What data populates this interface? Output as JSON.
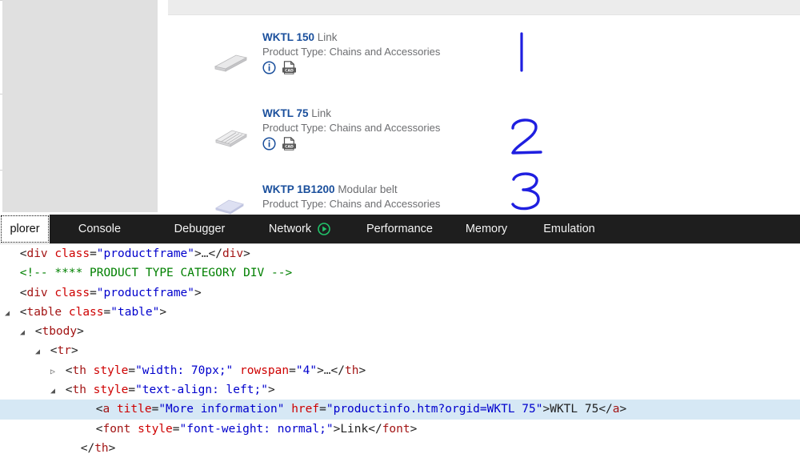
{
  "browser": {
    "products": [
      {
        "code": "WKTL 150",
        "name": "Link",
        "type_label": "Product Type: Chains and Accessories",
        "info_icon": "info-circle-icon",
        "cad_icon": "cad-file-icon",
        "thumbnail": "flat-bar-link-thumbnail",
        "annotation": "1"
      },
      {
        "code": "WKTL 75",
        "name": "Link",
        "type_label": "Product Type: Chains and Accessories",
        "info_icon": "info-circle-icon",
        "cad_icon": "cad-file-icon",
        "thumbnail": "slatted-link-thumbnail",
        "annotation": "2"
      },
      {
        "code": "WKTP 1B1200",
        "name": "Modular belt",
        "type_label": "Product Type: Chains and Accessories",
        "info_icon": "info-circle-icon",
        "cad_icon": "cad-file-icon",
        "thumbnail": "modular-belt-plate-thumbnail",
        "annotation": "3"
      }
    ],
    "colors": {
      "product_code_blue": "#1a4f9c",
      "body_gray": "#6d6e71",
      "panel_gray": "#e0e0e0",
      "header_band": "#ececec",
      "annotation_blue": "#1f1fe0"
    }
  },
  "devtools": {
    "tabs": [
      {
        "label": "plorer",
        "full_label": "DOM Explorer",
        "active": true,
        "icon": null
      },
      {
        "label": "Console",
        "active": false,
        "icon": null
      },
      {
        "label": "Debugger",
        "active": false,
        "icon": null
      },
      {
        "label": "Network",
        "active": false,
        "icon": "play-circle-icon"
      },
      {
        "label": "Performance",
        "active": false,
        "icon": null
      },
      {
        "label": "Memory",
        "active": false,
        "icon": null
      },
      {
        "label": "Emulation",
        "active": false,
        "icon": null
      }
    ],
    "colors": {
      "tabbar_bg": "#1e1e1e",
      "tab_text": "#f2f2f2",
      "selected_row_bg": "#d6e8f5",
      "tag_color": "#a31515",
      "attr_color": "#ce0000",
      "value_color": "#0000cd",
      "comment_color": "#008000"
    },
    "code_lines": [
      {
        "indent": 0,
        "twisty": "none",
        "selected": false,
        "tokens": [
          {
            "t": "punct",
            "v": "<"
          },
          {
            "t": "tw",
            "v": "div"
          },
          {
            "t": "punct",
            "v": " "
          },
          {
            "t": "attr",
            "v": "class"
          },
          {
            "t": "punct",
            "v": "="
          },
          {
            "t": "val",
            "v": "\"productframe\""
          },
          {
            "t": "punct",
            "v": ">"
          },
          {
            "t": "ell",
            "v": "…"
          },
          {
            "t": "punct",
            "v": "</"
          },
          {
            "t": "tw",
            "v": "div"
          },
          {
            "t": "punct",
            "v": ">"
          }
        ]
      },
      {
        "indent": 0,
        "twisty": "none",
        "selected": false,
        "tokens": [
          {
            "t": "cmt",
            "v": "<!-- **** PRODUCT TYPE CATEGORY DIV -->"
          }
        ]
      },
      {
        "indent": 0,
        "twisty": "none",
        "selected": false,
        "tokens": [
          {
            "t": "punct",
            "v": "<"
          },
          {
            "t": "tw",
            "v": "div"
          },
          {
            "t": "punct",
            "v": " "
          },
          {
            "t": "attr",
            "v": "class"
          },
          {
            "t": "punct",
            "v": "="
          },
          {
            "t": "val",
            "v": "\"productframe\""
          },
          {
            "t": "punct",
            "v": ">"
          }
        ]
      },
      {
        "indent": 0,
        "twisty": "open",
        "selected": false,
        "tokens": [
          {
            "t": "punct",
            "v": "<"
          },
          {
            "t": "tw",
            "v": "table"
          },
          {
            "t": "punct",
            "v": " "
          },
          {
            "t": "attr",
            "v": "class"
          },
          {
            "t": "punct",
            "v": "="
          },
          {
            "t": "val",
            "v": "\"table\""
          },
          {
            "t": "punct",
            "v": ">"
          }
        ]
      },
      {
        "indent": 1,
        "twisty": "open",
        "selected": false,
        "tokens": [
          {
            "t": "punct",
            "v": "<"
          },
          {
            "t": "tw",
            "v": "tbody"
          },
          {
            "t": "punct",
            "v": ">"
          }
        ]
      },
      {
        "indent": 2,
        "twisty": "open",
        "selected": false,
        "tokens": [
          {
            "t": "punct",
            "v": "<"
          },
          {
            "t": "tw",
            "v": "tr"
          },
          {
            "t": "punct",
            "v": ">"
          }
        ]
      },
      {
        "indent": 3,
        "twisty": "closed",
        "selected": false,
        "tokens": [
          {
            "t": "punct",
            "v": "<"
          },
          {
            "t": "tw",
            "v": "th"
          },
          {
            "t": "punct",
            "v": " "
          },
          {
            "t": "attr",
            "v": "style"
          },
          {
            "t": "punct",
            "v": "="
          },
          {
            "t": "val",
            "v": "\"width: 70px;\""
          },
          {
            "t": "punct",
            "v": " "
          },
          {
            "t": "attr",
            "v": "rowspan"
          },
          {
            "t": "punct",
            "v": "="
          },
          {
            "t": "val",
            "v": "\"4\""
          },
          {
            "t": "punct",
            "v": ">"
          },
          {
            "t": "ell",
            "v": "…"
          },
          {
            "t": "punct",
            "v": "</"
          },
          {
            "t": "tw",
            "v": "th"
          },
          {
            "t": "punct",
            "v": ">"
          }
        ]
      },
      {
        "indent": 3,
        "twisty": "open",
        "selected": false,
        "tokens": [
          {
            "t": "punct",
            "v": "<"
          },
          {
            "t": "tw",
            "v": "th"
          },
          {
            "t": "punct",
            "v": " "
          },
          {
            "t": "attr",
            "v": "style"
          },
          {
            "t": "punct",
            "v": "="
          },
          {
            "t": "val",
            "v": "\"text-align: left;\""
          },
          {
            "t": "punct",
            "v": ">"
          }
        ]
      },
      {
        "indent": 5,
        "twisty": "none",
        "selected": true,
        "tokens": [
          {
            "t": "punct",
            "v": "<"
          },
          {
            "t": "tw",
            "v": "a"
          },
          {
            "t": "punct",
            "v": " "
          },
          {
            "t": "attr",
            "v": "title"
          },
          {
            "t": "punct",
            "v": "="
          },
          {
            "t": "val",
            "v": "\"More information\""
          },
          {
            "t": "punct",
            "v": " "
          },
          {
            "t": "attr",
            "v": "href"
          },
          {
            "t": "punct",
            "v": "="
          },
          {
            "t": "val",
            "v": "\"productinfo.htm?orgid=WKTL 75\""
          },
          {
            "t": "punct",
            "v": ">"
          },
          {
            "t": "txt",
            "v": "WKTL 75"
          },
          {
            "t": "punct",
            "v": "</"
          },
          {
            "t": "tw",
            "v": "a"
          },
          {
            "t": "punct",
            "v": ">"
          }
        ]
      },
      {
        "indent": 5,
        "twisty": "none",
        "selected": false,
        "tokens": [
          {
            "t": "punct",
            "v": "<"
          },
          {
            "t": "tw",
            "v": "font"
          },
          {
            "t": "punct",
            "v": " "
          },
          {
            "t": "attr",
            "v": "style"
          },
          {
            "t": "punct",
            "v": "="
          },
          {
            "t": "val",
            "v": "\"font-weight: normal;\""
          },
          {
            "t": "punct",
            "v": ">"
          },
          {
            "t": "txt",
            "v": "Link"
          },
          {
            "t": "punct",
            "v": "</"
          },
          {
            "t": "tw",
            "v": "font"
          },
          {
            "t": "punct",
            "v": ">"
          }
        ]
      },
      {
        "indent": 4,
        "twisty": "none",
        "selected": false,
        "tokens": [
          {
            "t": "punct",
            "v": "</"
          },
          {
            "t": "tw",
            "v": "th"
          },
          {
            "t": "punct",
            "v": ">"
          }
        ]
      }
    ]
  }
}
